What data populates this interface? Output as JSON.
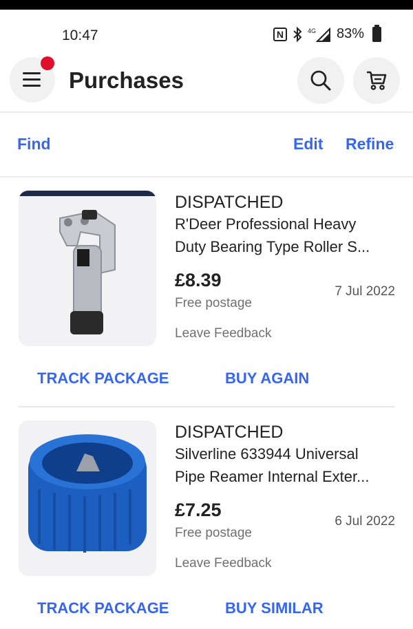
{
  "status_bar": {
    "time": "10:47",
    "network": "4G",
    "battery": "83%"
  },
  "header": {
    "title": "Purchases",
    "menu_icon": "hamburger-menu-icon",
    "search_icon": "search-icon",
    "cart_icon": "cart-icon",
    "notification_color": "#e0102c"
  },
  "actions": {
    "find": "Find",
    "edit": "Edit",
    "refine": "Refine"
  },
  "items": [
    {
      "status": "DISPATCHED",
      "name_line1": "R'Deer Professional Heavy",
      "name_line2": "Duty Bearing Type Roller S...",
      "price": "£8.39",
      "date": "7 Jul 2022",
      "postage": "Free postage",
      "feedback": "Leave Feedback",
      "primary_action": "TRACK PACKAGE",
      "secondary_action": "BUY AGAIN"
    },
    {
      "status": "DISPATCHED",
      "name_line1": "Silverline 633944 Universal",
      "name_line2": "Pipe Reamer Internal Exter...",
      "price": "£7.25",
      "date": "6 Jul 2022",
      "postage": "Free postage",
      "feedback": "Leave Feedback",
      "primary_action": "TRACK PACKAGE",
      "secondary_action": "BUY SIMILAR"
    }
  ],
  "colors": {
    "accent": "#3665f3",
    "text": "#191919",
    "muted": "#707070"
  }
}
